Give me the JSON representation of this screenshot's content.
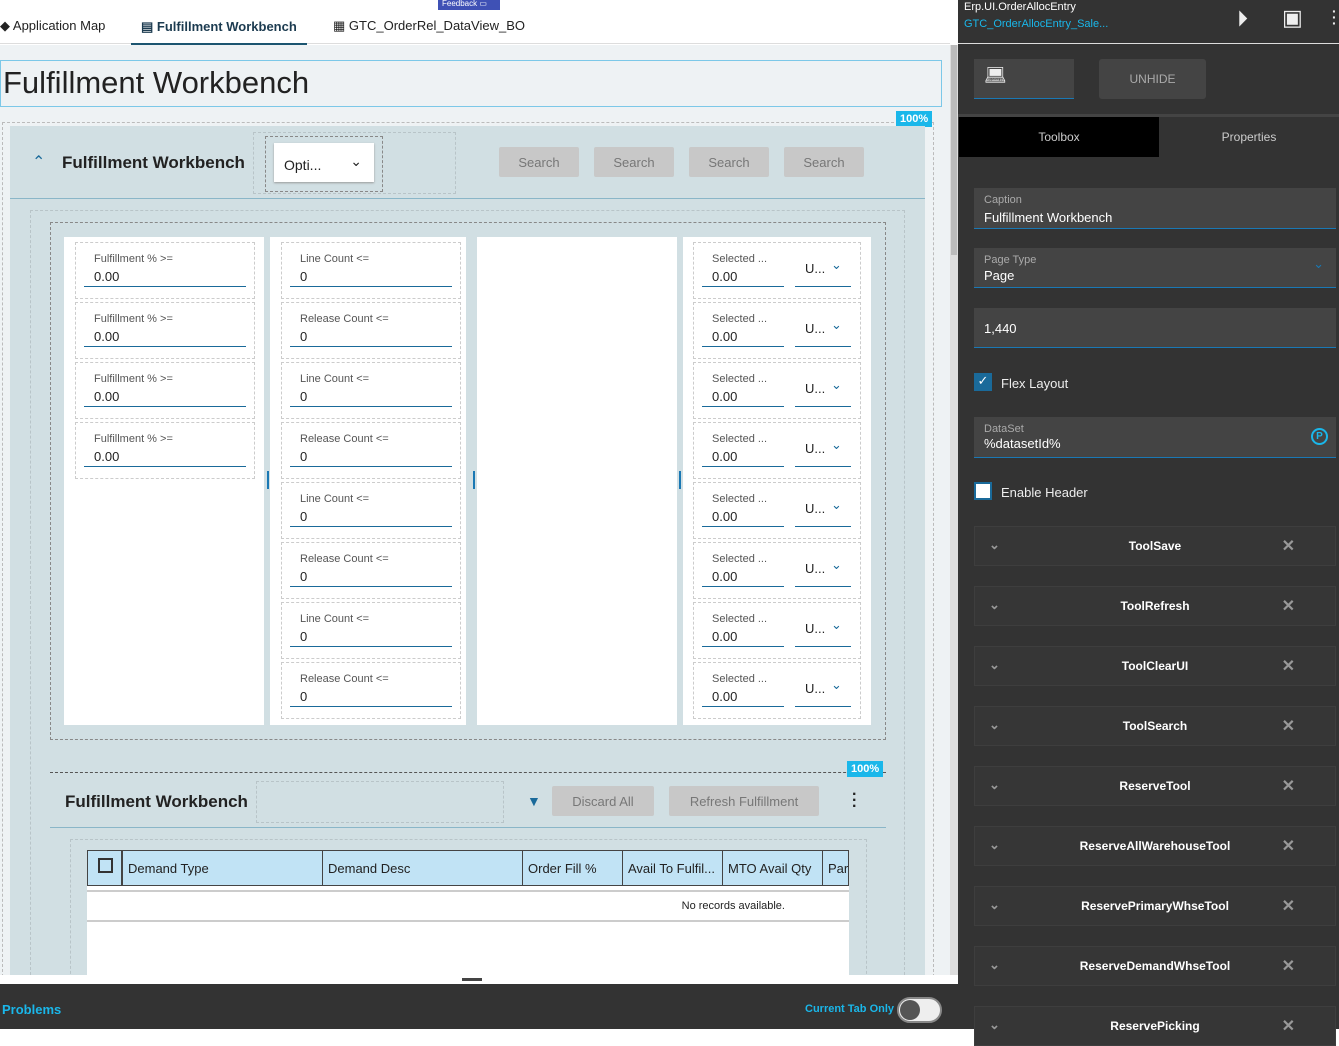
{
  "tabs": [
    {
      "label": "Application Map"
    },
    {
      "label": "Fulfillment Workbench"
    },
    {
      "label": "GTC_OrderRel_DataView_BO"
    }
  ],
  "feedback": "Feedback",
  "page_title": "Fulfillment Workbench",
  "zoom_badge": "100%",
  "panel": {
    "title": "Fulfillment Workbench",
    "options_label": "Opti...",
    "search_buttons": [
      "Search",
      "Search",
      "Search",
      "Search"
    ]
  },
  "filters": {
    "col1": [
      {
        "label": "Fulfillment % >=",
        "value": "0.00"
      },
      {
        "label": "Fulfillment % >=",
        "value": "0.00"
      },
      {
        "label": "Fulfillment % >=",
        "value": "0.00"
      },
      {
        "label": "Fulfillment % >=",
        "value": "0.00"
      }
    ],
    "col2": [
      {
        "label": "Line Count <=",
        "value": "0"
      },
      {
        "label": "Release Count <=",
        "value": "0"
      },
      {
        "label": "Line Count <=",
        "value": "0"
      },
      {
        "label": "Release Count <=",
        "value": "0"
      },
      {
        "label": "Line Count <=",
        "value": "0"
      },
      {
        "label": "Release Count <=",
        "value": "0"
      },
      {
        "label": "Line Count <=",
        "value": "0"
      },
      {
        "label": "Release Count <=",
        "value": "0"
      }
    ],
    "col4": {
      "label": "Selected ...",
      "value": "0.00",
      "unit": "U...",
      "count": 8
    }
  },
  "grid_section": {
    "title": "Fulfillment Workbench",
    "zoom_badge": "100%",
    "discard_label": "Discard All",
    "refresh_label": "Refresh Fulfillment",
    "columns": [
      "Demand Type",
      "Demand Desc",
      "Order Fill %",
      "Avail To Fulfil...",
      "MTO Avail Qty",
      "Par"
    ],
    "empty_text": "No records available."
  },
  "bottom": {
    "problems": "Problems",
    "current_tab_only": "Current Tab Only",
    "toggle_on": false
  },
  "right": {
    "app_name": "Erp.UI.OrderAllocEntry",
    "layer_name": "GTC_OrderAllocEntry_Sale...",
    "unhide": "UNHIDE",
    "tabs": [
      "Toolbox",
      "Properties"
    ],
    "caption_label": "Caption",
    "caption_value": "Fulfillment Workbench",
    "page_type_label": "Page Type",
    "page_type_value": "Page",
    "width_value": "1,440",
    "flex_layout": "Flex Layout",
    "flex_checked": true,
    "dataset_label": "DataSet",
    "dataset_value": "%datasetId%",
    "enable_header": "Enable Header",
    "enable_header_checked": false,
    "tools": [
      "ToolSave",
      "ToolRefresh",
      "ToolClearUI",
      "ToolSearch",
      "ReserveTool",
      "ReserveAllWarehouseTool",
      "ReservePrimaryWhseTool",
      "ReserveDemandWhseTool",
      "ReservePicking"
    ]
  }
}
